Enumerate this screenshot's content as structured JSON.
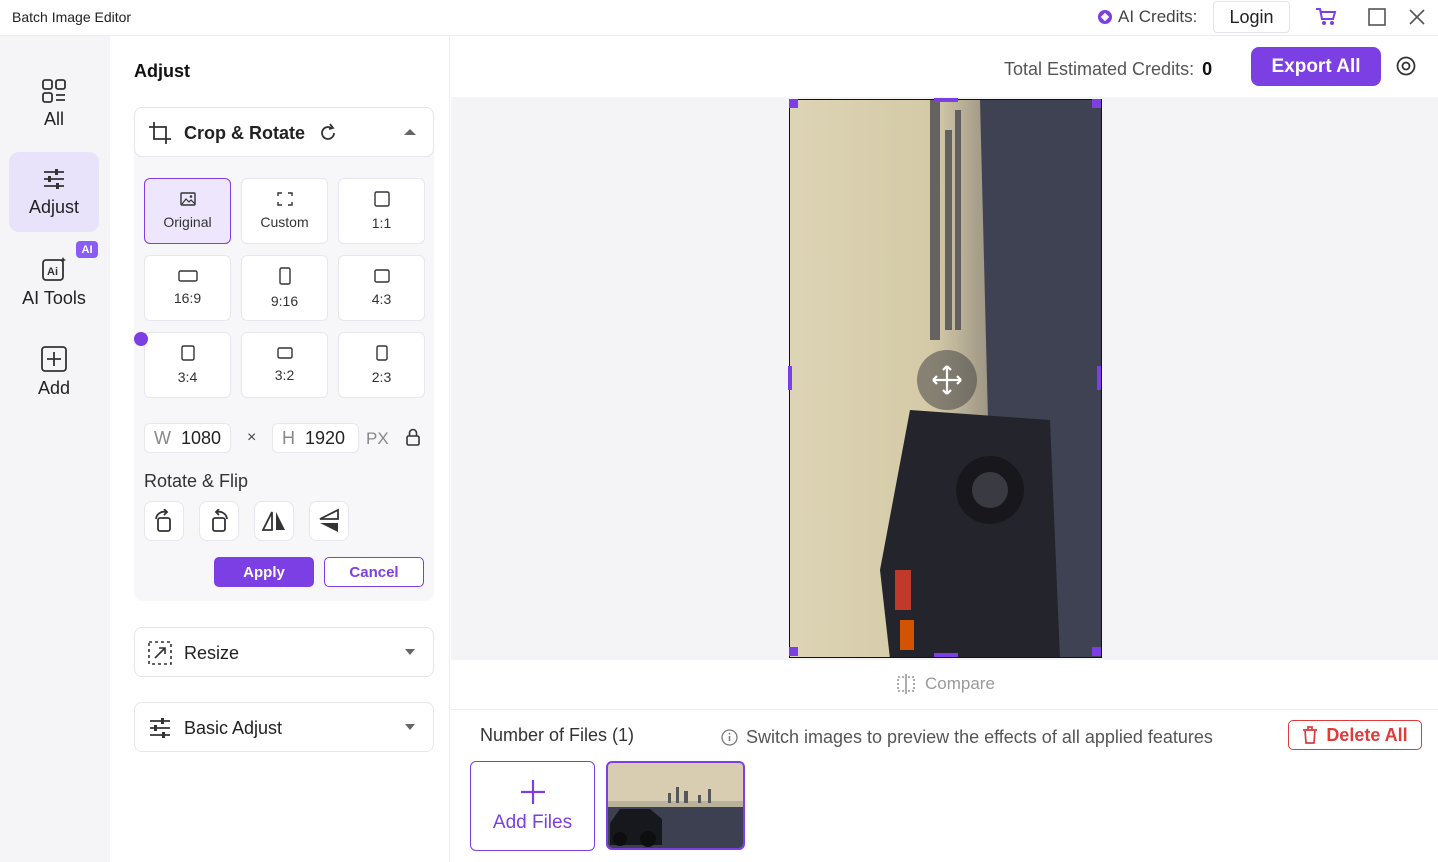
{
  "window": {
    "title": "Batch Image Editor",
    "ai_credits_label": "AI Credits:",
    "login_label": "Login"
  },
  "rail": {
    "items": [
      {
        "label": "All",
        "icon": "grid-icon"
      },
      {
        "label": "Adjust",
        "icon": "sliders-icon"
      },
      {
        "label": "AI Tools",
        "icon": "ai-tools-icon"
      },
      {
        "label": "Add",
        "icon": "plus-square-icon"
      }
    ],
    "ai_badge": "AI"
  },
  "panel": {
    "title": "Adjust",
    "crop": {
      "label": "Crop & Rotate",
      "ratios": [
        "Original",
        "Custom",
        "1:1",
        "16:9",
        "9:16",
        "4:3",
        "3:4",
        "3:2",
        "2:3"
      ],
      "selected": "Original",
      "width_key": "W",
      "width_value": "1080",
      "times": "×",
      "height_key": "H",
      "height_value": "1920",
      "unit": "PX",
      "rotate_flip_label": "Rotate & Flip",
      "apply_label": "Apply",
      "cancel_label": "Cancel"
    },
    "resize_label": "Resize",
    "basic_adjust_label": "Basic Adjust"
  },
  "main": {
    "total_credits_label": "Total Estimated Credits:",
    "total_credits_value": "0",
    "export_label": "Export All",
    "compare_label": "Compare",
    "files_count_label": "Number of Files (1)",
    "hint": "Switch images to preview the effects of all applied features",
    "delete_all_label": "Delete All",
    "add_files_label": "Add Files"
  },
  "colors": {
    "accent": "#7b3fe4",
    "danger": "#e03b3b"
  }
}
